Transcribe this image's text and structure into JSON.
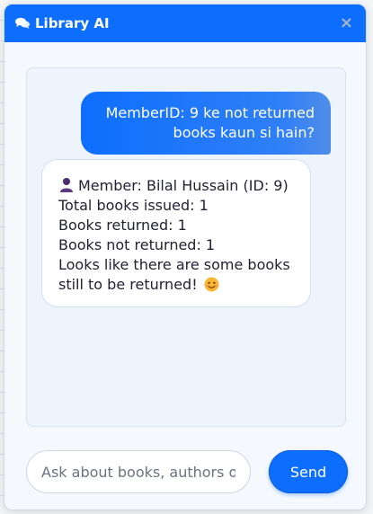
{
  "header": {
    "title": "Library AI",
    "icon": "comments-icon",
    "close_label": "×"
  },
  "messages": {
    "user": {
      "text": "MemberID: 9 ke not returned books kaun si hain?"
    },
    "bot": {
      "line1": "Member: Bilal Hussain (ID: 9)",
      "line2": "Total books issued: 1",
      "line3": "Books returned: 1",
      "line4": "Books not returned: 1",
      "line5": "Looks like there are some books still to be returned!",
      "person_icon": "person-icon",
      "emoji_icon": "smiling-face-icon"
    }
  },
  "composer": {
    "placeholder": "Ask about books, authors or members...",
    "send_label": "Send"
  },
  "colors": {
    "accent": "#0d6efd",
    "bot_bubble": "#ffffff",
    "chat_bg": "#eef4fc"
  }
}
